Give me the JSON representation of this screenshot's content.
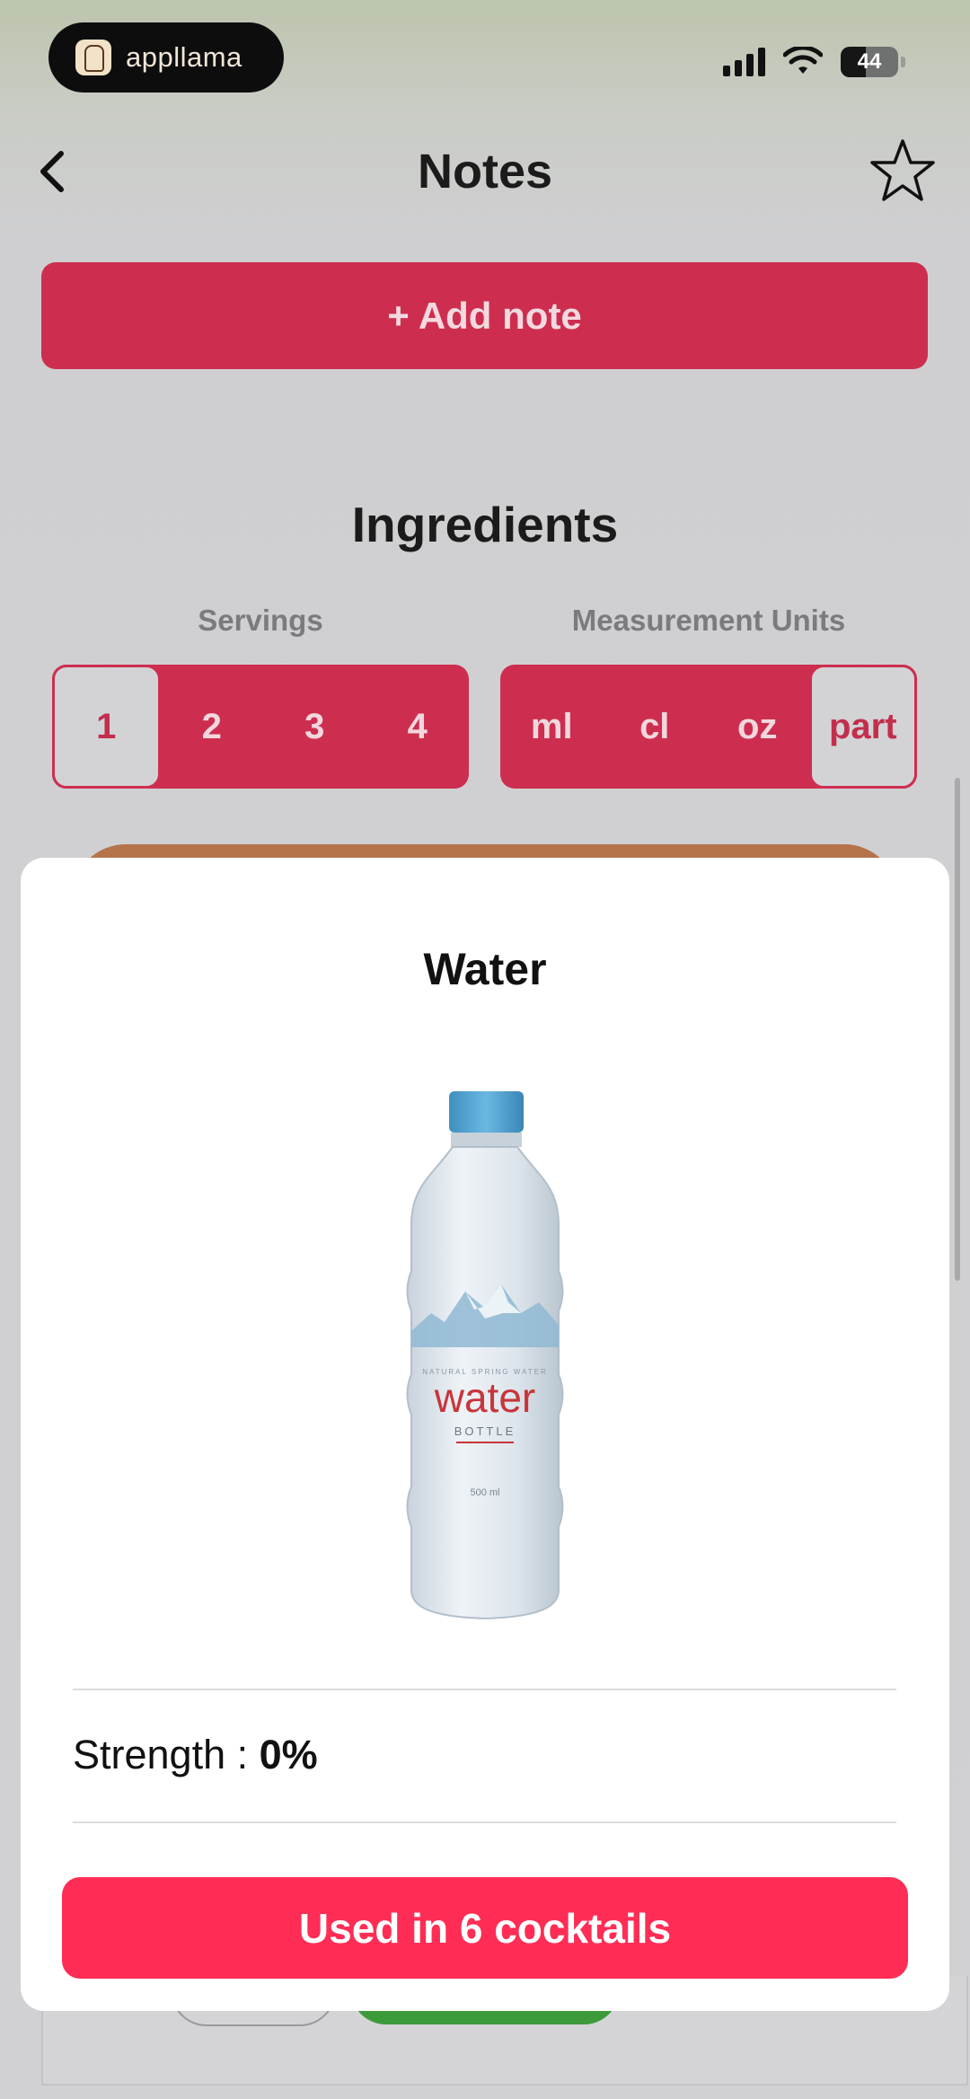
{
  "status_bar": {
    "app_badge_label": "appllama",
    "battery_level": "44",
    "icons": [
      "llama-logo-icon",
      "signal-icon",
      "wifi-icon",
      "battery-icon"
    ]
  },
  "header": {
    "title": "Notes",
    "back_icon": "chevron-left-icon",
    "favorite_icon": "star-outline-icon"
  },
  "add_note_label": "+ Add note",
  "ingredients": {
    "title": "Ingredients",
    "servings": {
      "label": "Servings",
      "options": [
        "1",
        "2",
        "3",
        "4"
      ],
      "selected": "1"
    },
    "units": {
      "label": "Measurement Units",
      "options": [
        "ml",
        "cl",
        "oz",
        "part"
      ],
      "selected": "part"
    }
  },
  "modal": {
    "title": "Water",
    "bottle_label": {
      "top": "NATURAL SPRING WATER",
      "brand": "water",
      "sub": "BOTTLE",
      "volume": "500 ml"
    },
    "strength_label": "Strength : ",
    "strength_value": "0%",
    "used_in_label": "Used in 6 cocktails"
  },
  "colors": {
    "accent": "#cd2e4f",
    "primary_button": "#ff2d55",
    "background": "#d1d1d4"
  }
}
